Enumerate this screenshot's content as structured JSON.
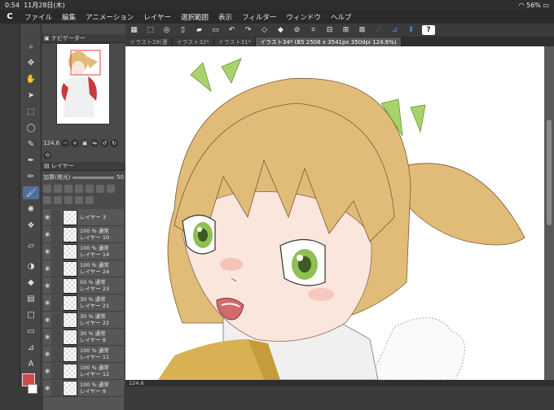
{
  "status": {
    "time": "0:54",
    "date": "11月28日(木)",
    "battery": "56%"
  },
  "menu": {
    "logo": "C",
    "items": [
      "ファイル",
      "編集",
      "アニメーション",
      "レイヤー",
      "選択範囲",
      "表示",
      "フィルター",
      "ウィンドウ",
      "ヘルプ"
    ]
  },
  "tabs": [
    {
      "label": "イラスト28(漫"
    },
    {
      "label": "イラスト32*"
    },
    {
      "label": "イラスト31*"
    },
    {
      "label": "イラスト34* (B5 2508 x 3541px 350dpi 124.6%)"
    }
  ],
  "navigator": {
    "title": "ナビゲーター",
    "zoom": "124.6"
  },
  "layer_panel": {
    "title": "レイヤー",
    "blend_mode": "加算(発光)",
    "opacity": "50",
    "layers": [
      {
        "line1": "",
        "line2": "レイヤー 3"
      },
      {
        "line1": "100 % 通常",
        "line2": "レイヤー 10"
      },
      {
        "line1": "100 % 通常",
        "line2": "レイヤー 14"
      },
      {
        "line1": "100 % 通常",
        "line2": "レイヤー 24"
      },
      {
        "line1": "50 % 通常",
        "line2": "レイヤー 23"
      },
      {
        "line1": "30 % 通常",
        "line2": "レイヤー 21"
      },
      {
        "line1": "30 % 通常",
        "line2": "レイヤー 22"
      },
      {
        "line1": "30 % 通常",
        "line2": "レイヤー 8"
      },
      {
        "line1": "100 % 通常",
        "line2": "レイヤー 11"
      },
      {
        "line1": "100 % 通常",
        "line2": "レイヤー 12"
      },
      {
        "line1": "100 % 通常",
        "line2": "レイヤー 9"
      }
    ]
  },
  "bottom": {
    "zoom": "124.6"
  },
  "colors": {
    "main": "#d24a4a",
    "sub": "#ffffff",
    "hair": "#e0bc78",
    "ribbon": "#a6d46a",
    "eye": "#8fbf55"
  }
}
